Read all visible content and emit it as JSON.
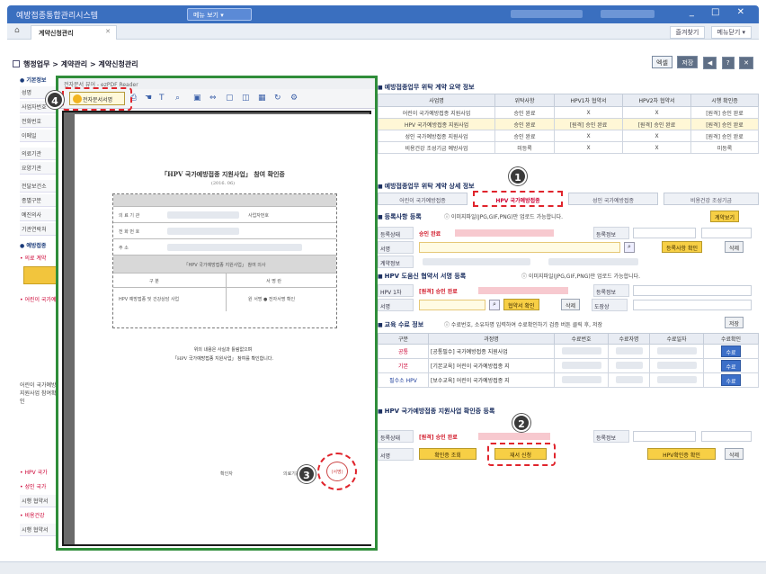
{
  "window": {
    "app_title": "예방접종통합관리시스템",
    "menu_button": "메뉴 보기 ▾",
    "controls": "_ □ ✕"
  },
  "tabbar": {
    "home_icon": "home-icon",
    "tab_label": "계약신청관리",
    "right_items": [
      "즐겨찾기",
      "메뉴닫기 ▾"
    ]
  },
  "breadcrumb": "행정업무 > 계약관리 > 계약신청관리",
  "toolbar": {
    "buttons": [
      "엑셀",
      "저장",
      "◀",
      "?",
      "✕"
    ]
  },
  "leftcol": {
    "section1": "● 기본정보",
    "labels": [
      "성명",
      "사업자번호",
      "전화번호",
      "이메일",
      "의료기관",
      "요양기관",
      "전달보건소",
      "종별구분",
      "예진의사",
      "기관연락처"
    ],
    "section2": "● 예방접종",
    "red1": "• 의료 계약",
    "red2": "• 어린이 국가예방",
    "body_text": "어린이 국가예방 지원사업 참여확인",
    "bottom_items": [
      "• HPV 국가",
      "• 성인 국가",
      "시행 협약서",
      "• 비용건강",
      "시행 협약서"
    ]
  },
  "viewer": {
    "title": "전자문서 뷰어 - ezPDF Reader",
    "signature_button": "전자문서서명",
    "doc_title": "「HPV 국가예방접종 지원사업」 참여 확인증",
    "doc_subtitle": "(2016. 06)",
    "doc_rows": [
      "의 료 기 관",
      "사업자번호",
      "전 화 번 호",
      "주 소"
    ],
    "doc_middle": "「HPV 국가예방접종 지원사업」 참여 의사",
    "doc_sign_header": [
      "구 분",
      "서 명 란"
    ],
    "doc_sign_row": [
      "HPV 예방접종 및 건강상담 사업",
      "원 서명 ● 전자서명 확인"
    ],
    "doc_confirm_lines": [
      "위의 내용은 사실과 틀림없으며",
      "「HPV 국가예방접종 지원사업」 참여를 확인합니다."
    ],
    "doc_footer_left": "확인자",
    "doc_footer_right": "의료기관장",
    "stamp_text": "(서명)"
  },
  "summary": {
    "title": "예방접종업무 위탁 계약 요약 정보",
    "headers": [
      "사업명",
      "위탁사항",
      "HPV1차 협약서",
      "HPV2차 협약서",
      "시행 확인증"
    ],
    "rows": [
      [
        "어린이 국가예방접종 지원사업",
        "승인 완료",
        "X",
        "X",
        "[원격] 승인 완료"
      ],
      [
        "HPV 국가예방접종 지원사업",
        "승인 완료",
        "[원격] 승인 완료",
        "[원격] 승인 완료",
        "[원격] 승인 완료"
      ],
      [
        "성인 국가예방접종 지원사업",
        "승인 완료",
        "X",
        "X",
        "[원격] 승인 완료"
      ],
      [
        "비용건강 조성기금 예방사업",
        "미등록",
        "X",
        "X",
        "미등록"
      ]
    ]
  },
  "detail": {
    "title": "예방접종업무 위탁 계약 상세 정보",
    "tabs": [
      "어린이 국가예방접종",
      "HPV 국가예방접종",
      "성인 국가예방접종",
      "비용건강 조성기금"
    ],
    "print_button": "계약보기",
    "section_sign": "등록사항 등록",
    "sign_note": "이미지파일(JPG,GIF,PNG)만 업로드 가능합니다.",
    "status_label": "등록상태",
    "status_value": "승인 완료",
    "reg_info_label": "등록정보",
    "sign_label": "서명",
    "sign_confirm_btn": "등록사항 확인",
    "delete_btn": "삭제",
    "agreement_label": "계약정보",
    "hpv_section": "HPV 도움신 협약서 서명 등록",
    "hpv_note": "이미지파일(JPG,GIF,PNG)만 업로드 가능합니다.",
    "hpv_label": "HPV 1차",
    "hpv_status": "[원격] 승인 완료",
    "hpv_reg": "등록정보",
    "hpv_sign": "서명",
    "hpv_confirm_btn": "협약서 확인",
    "hpv_delete_btn": "삭제",
    "hpv_manager": "도장상",
    "edu_section": "교육 수료 정보",
    "edu_note": "수료번호, 소유자명 입력하여 수료확인하기 검증 버튼 클릭 후, 저장",
    "edu_btn": "저장",
    "edu_headers": [
      "구분",
      "과정명",
      "수료번호",
      "수료자명",
      "수료일자",
      "수료확인"
    ],
    "edu_rows": [
      [
        "공통",
        "[공통필수] 국가예방접종 지원사업",
        "수료"
      ],
      [
        "기본",
        "[기본교육] 어린이 국가예방접종 지",
        "수료"
      ],
      [
        "필수소 HPV",
        "[보수교육] 어린이 국가예방접종 지",
        "수료"
      ]
    ],
    "hpv_cert_section": "HPV 국가예방접종 지원사업 확인증 등록",
    "cert_status_label": "등록상태",
    "cert_status": "[원격] 승인 완료",
    "cert_reg_label": "등록정보",
    "cert_sign_label": "서명",
    "cert_view_btn": "확인증 조회",
    "cert_sign_btn": "재서 신청",
    "cert_hpv_btn": "HPV확인증 확인",
    "cert_delete_btn": "삭제"
  },
  "markers": [
    "1",
    "2",
    "3",
    "4"
  ],
  "colors": {
    "title_bar": "#3a6fbf",
    "viewer_border": "#2f8d3a",
    "highlight_dash": "#e0242c",
    "button_yellow": "#f7cf45"
  }
}
